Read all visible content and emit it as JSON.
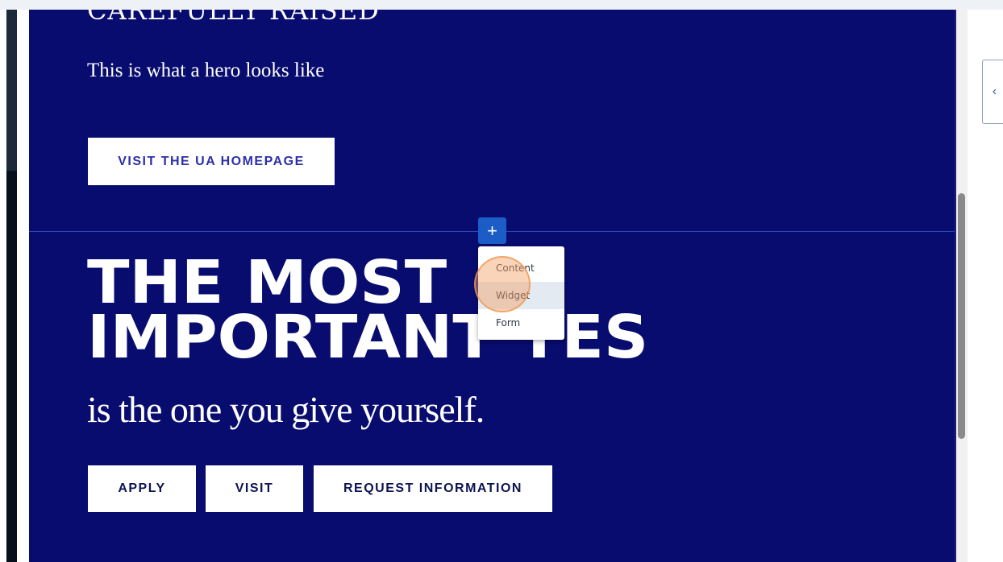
{
  "hero": {
    "clipped_heading": "CAREFULLY RAISED",
    "subtitle": "This is what a hero looks like",
    "button_label": "VISIT THE UA HOMEPAGE"
  },
  "editor": {
    "add_button_symbol": "+",
    "menu_items": [
      "Content",
      "Widget",
      "Form"
    ],
    "hovered_item": "Widget",
    "panel_toggle_symbol": "‹"
  },
  "section2": {
    "title_line1": "THE MOST",
    "title_line2": "IMPORTANT YES",
    "tagline": "is the one you give yourself.",
    "buttons": [
      "APPLY",
      "VISIT",
      "REQUEST INFORMATION"
    ]
  },
  "colors": {
    "canvas_bg": "#080c6e",
    "hero_button_text": "#2c2fa8",
    "cta_text": "#0d1454",
    "add_button_bg": "#1c5cc7"
  },
  "icons": {
    "add": "plus-icon",
    "panel_toggle": "chevron-left-icon"
  }
}
